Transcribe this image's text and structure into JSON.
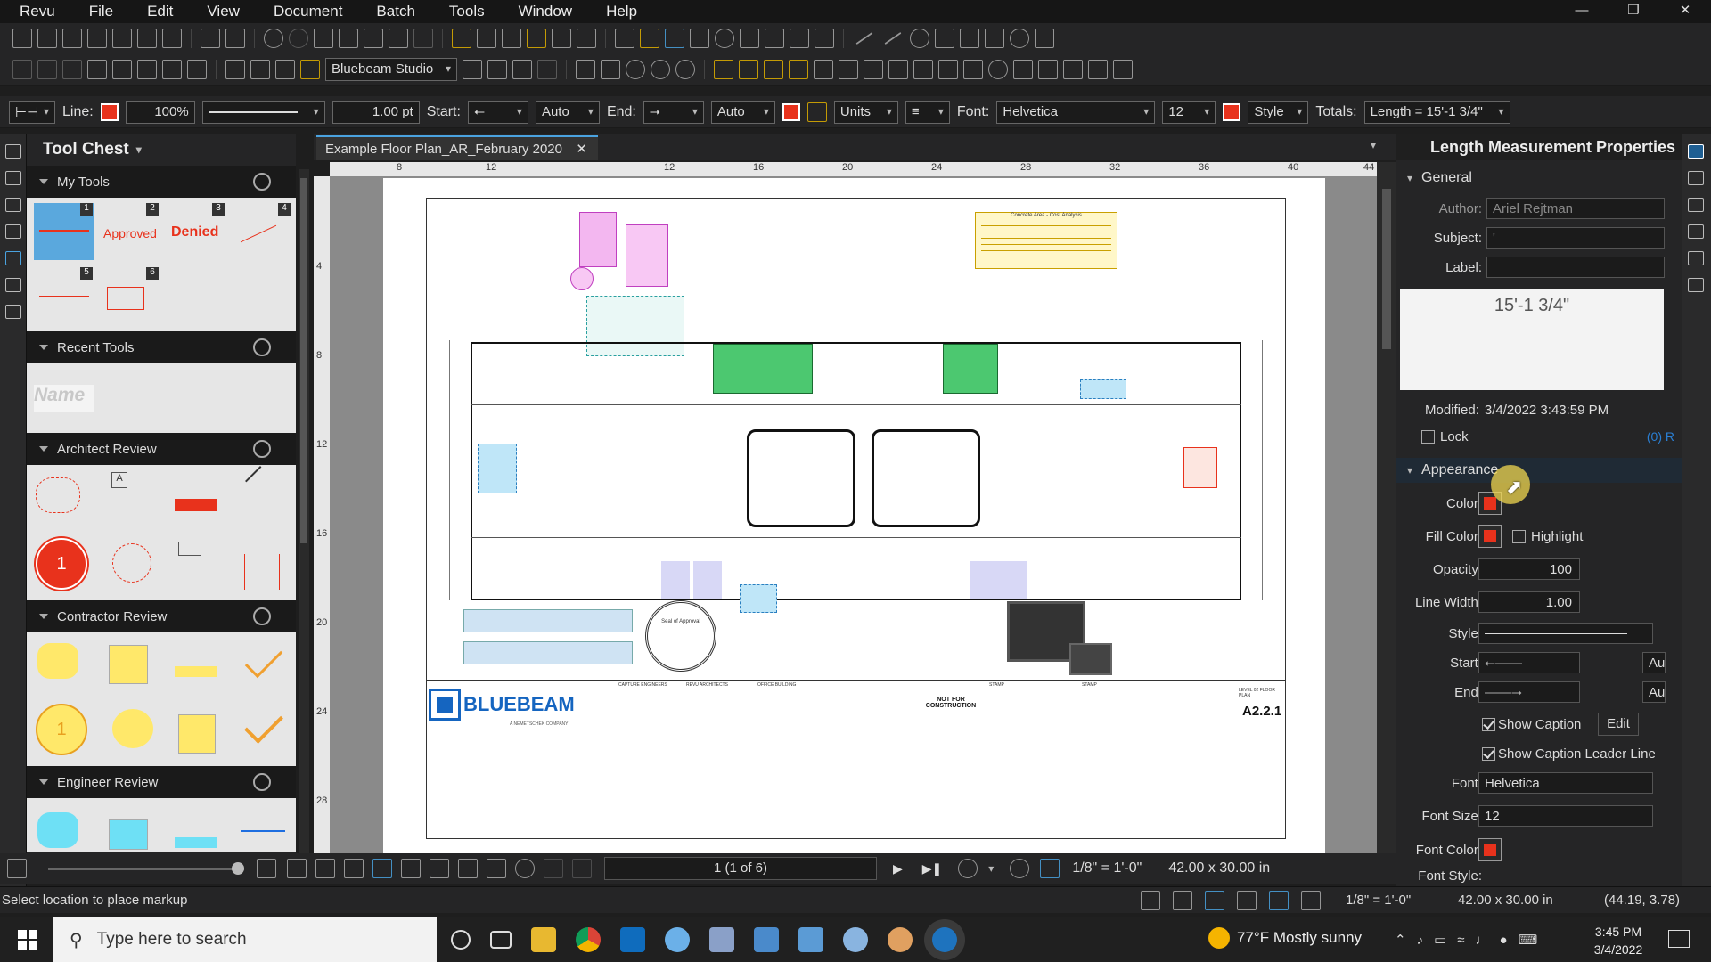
{
  "menubar": {
    "items": [
      "Revu",
      "File",
      "Edit",
      "View",
      "Document",
      "Batch",
      "Tools",
      "Window",
      "Help"
    ]
  },
  "toolbar2": {
    "profile": "Bluebeam Studio"
  },
  "props_toolbar": {
    "line_label": "Line:",
    "line_opacity": "100%",
    "line_width": "1.00 pt",
    "start_label": "Start:",
    "start_auto": "Auto",
    "end_label": "End:",
    "end_auto": "Auto",
    "units": "Units",
    "font_label": "Font:",
    "font": "Helvetica",
    "font_size": "12",
    "style": "Style",
    "totals_label": "Totals:",
    "totals": "Length = 15'-1 3/4\"",
    "accent_color": "#e8321c"
  },
  "toolchest": {
    "title": "Tool Chest",
    "sections": [
      {
        "label": "My Tools",
        "numbers": [
          "1",
          "2",
          "3",
          "4",
          "5",
          "6"
        ],
        "approved": "Approved",
        "denied": "Denied"
      },
      {
        "label": "Recent Tools",
        "placeholder": "Name"
      },
      {
        "label": "Architect Review",
        "circle": "1"
      },
      {
        "label": "Contractor Review",
        "circle": "1"
      },
      {
        "label": "Engineer Review"
      }
    ]
  },
  "document": {
    "tab": "Example Floor Plan_AR_February 2020",
    "ruler_top": [
      "8",
      "12",
      "16",
      "20",
      "24",
      "28",
      "32",
      "36",
      "40",
      "44"
    ],
    "ruler_left": [
      "4",
      "8",
      "12",
      "16",
      "20",
      "24",
      "28"
    ],
    "drawing": {
      "table_title": "Concrete Area - Cost Analysis",
      "seal": "Seal of Approval",
      "logo": "BLUEBEAM",
      "logo_sub": "A NEMETSCHEK COMPANY",
      "capture": "CAPTURE ENGINEERS",
      "revu_arch": "REVU ARCHITECTS",
      "office": "OFFICE BUILDING",
      "nfc": "NOT FOR CONSTRUCTION",
      "stamp": "STAMP",
      "sheet_title": "LEVEL 02 FLOOR PLAN",
      "sheet": "A2.2.1"
    }
  },
  "bottombar": {
    "page": "1 (1 of 6)",
    "scale": "1/8\" = 1'-0\"",
    "size": "42.00 x 30.00 in"
  },
  "statusbar": {
    "message": "Select location to place markup",
    "scale": "1/8\" = 1'-0\"",
    "size": "42.00 x 30.00 in",
    "coords": "(44.19, 3.78)"
  },
  "properties": {
    "title": "Length Measurement Properties",
    "general": "General",
    "author_label": "Author:",
    "author": "Ariel Rejtman",
    "subject_label": "Subject:",
    "subject": "'",
    "label_label": "Label:",
    "label": "",
    "preview": "15'-1 3/4\"",
    "modified_label": "Modified:",
    "modified": "3/4/2022 3:43:59 PM",
    "lock": "Lock",
    "link": "(0) R",
    "appearance": "Appearance",
    "color_label": "Color:",
    "fill_label": "Fill Color:",
    "highlight": "Highlight",
    "opacity_label": "Opacity:",
    "opacity": "100",
    "linewidth_label": "Line Width:",
    "linewidth": "1.00",
    "style_label": "Style:",
    "start_label": "Start:",
    "end_label": "End:",
    "auto_short": "Au",
    "show_caption": "Show Caption",
    "edit": "Edit",
    "show_leader": "Show Caption Leader Line",
    "font_label": "Font:",
    "font": "Helvetica",
    "fontsize_label": "Font Size:",
    "fontsize": "12",
    "fontcolor_label": "Font Color:",
    "fontstyle_label": "Font Style:"
  },
  "taskbar": {
    "search_placeholder": "Type here to search",
    "weather": "77°F  Mostly sunny",
    "time": "3:45 PM",
    "date": "3/4/2022"
  }
}
